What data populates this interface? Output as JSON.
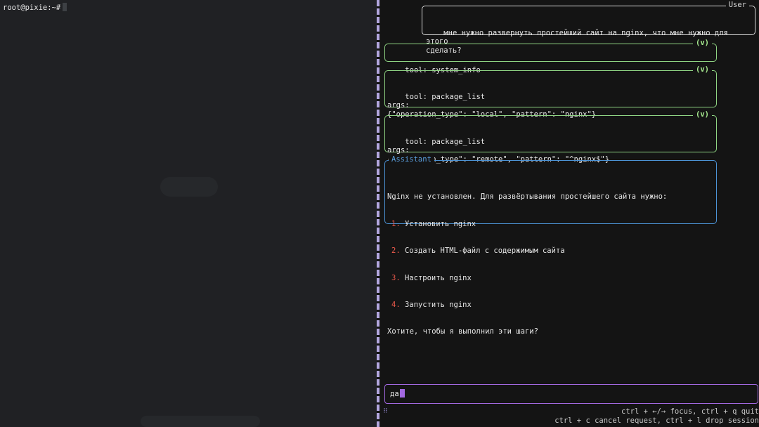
{
  "terminal": {
    "prompt": "root@pixie:~#"
  },
  "chat": {
    "user_label": "User",
    "user_message": "мне нужно развернуть простейший сайт на nginx, что мне нужно для этого\nсделать?",
    "tool_calls": [
      {
        "status": "(v)",
        "text": "tool: system_info"
      },
      {
        "status": "(v)",
        "text": "tool: package_list\nargs:\n{\"operation_type\": \"local\", \"pattern\": \"nginx\"}"
      },
      {
        "status": "(v)",
        "text": "tool: package_list\nargs:\n{\"operation_type\": \"remote\", \"pattern\": \"^nginx$\"}"
      }
    ],
    "assistant_label": "Assistant",
    "assistant_intro": "Nginx не установлен. Для развёртывания простейшего сайта нужно:",
    "assistant_steps": [
      {
        "num": "1.",
        "text": "Установить nginx"
      },
      {
        "num": "2.",
        "text": "Создать HTML-файл с содержимым сайта"
      },
      {
        "num": "3.",
        "text": "Настроить nginx"
      },
      {
        "num": "4.",
        "text": "Запустить nginx"
      }
    ],
    "assistant_outro": "Хотите, чтобы я выполнил эти шаги?"
  },
  "input": {
    "value": "да"
  },
  "footer": {
    "grip": "⠿",
    "hint_line_1": "ctrl + ←/→ focus, ctrl + q quit",
    "hint_line_2": "ctrl + c cancel request, ctrl + l drop session"
  },
  "colors": {
    "tool_border": "#8fd483",
    "assistant_border": "#4c93d6",
    "input_border": "#a268e0",
    "step_number": "#ef5a4c"
  }
}
